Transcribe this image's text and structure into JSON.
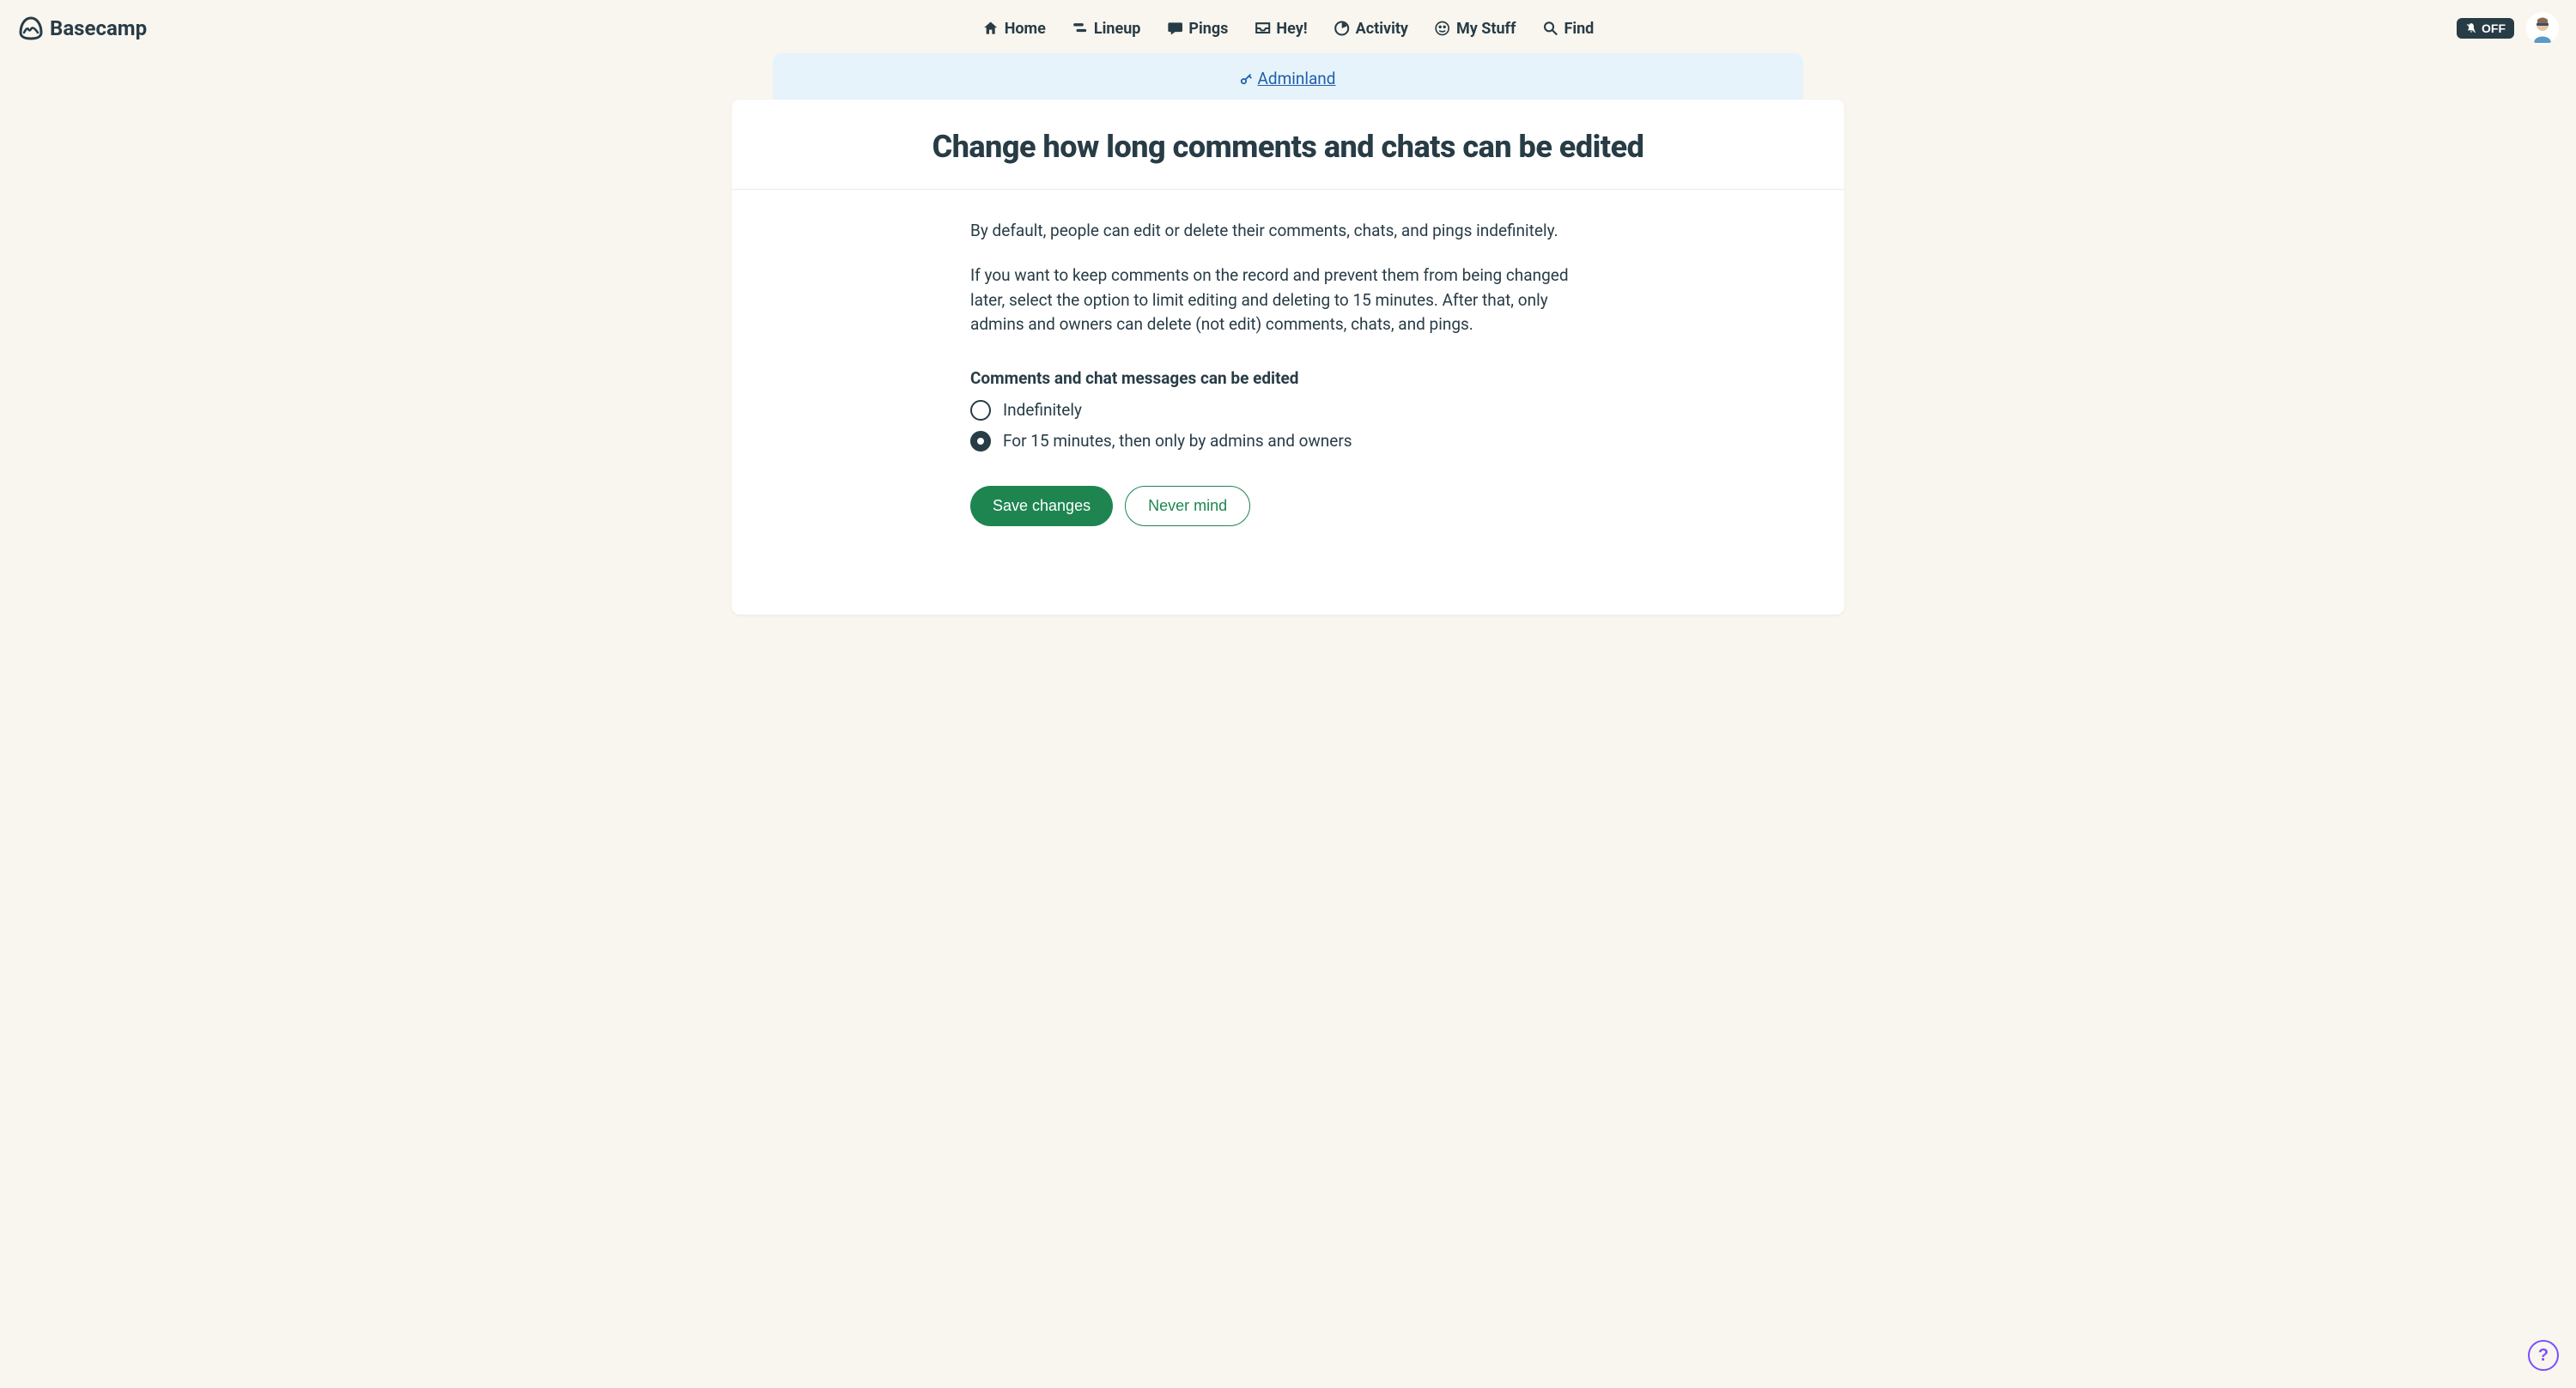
{
  "brand": "Basecamp",
  "nav": {
    "home": "Home",
    "lineup": "Lineup",
    "pings": "Pings",
    "hey": "Hey!",
    "activity": "Activity",
    "mystuff": "My Stuff",
    "find": "Find"
  },
  "notif_toggle": "OFF",
  "adminland_link": "Adminland",
  "page_title": "Change how long comments and chats can be edited",
  "intro_paragraph_1": "By default, people can edit or delete their comments, chats, and pings indefinitely.",
  "intro_paragraph_2": "If you want to keep comments on the record and prevent them from being changed later, select the option to limit editing and deleting to 15 minutes. After that, only admins and owners can delete (not edit) comments, chats, and pings.",
  "section_label": "Comments and chat messages can be edited",
  "options": {
    "indefinitely": "Indefinitely",
    "limited": "For 15 minutes, then only by admins and owners"
  },
  "selected_option": "limited",
  "buttons": {
    "save": "Save changes",
    "cancel": "Never mind"
  },
  "help_label": "?"
}
